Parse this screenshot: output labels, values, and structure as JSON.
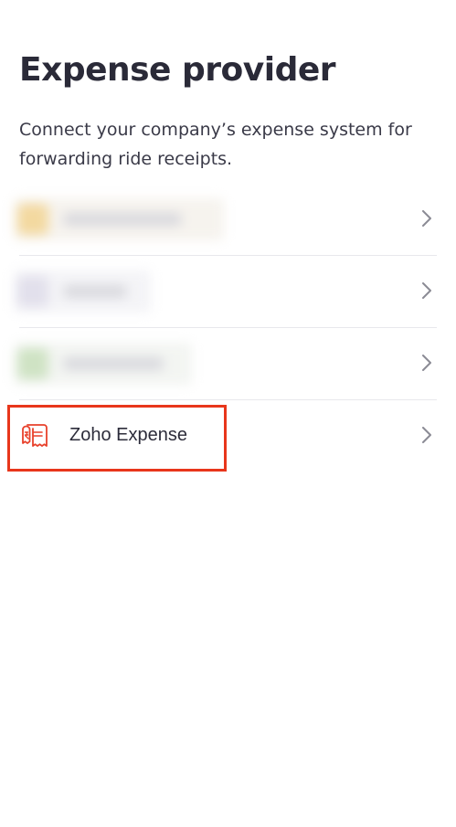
{
  "header": {
    "title": "Expense provider",
    "subtitle": "Connect your company’s expense system for forwarding ride receipts."
  },
  "providers": [
    {
      "label": "",
      "redacted": true,
      "logo_color": "#f3d9a0"
    },
    {
      "label": "",
      "redacted": true,
      "logo_color": "#e2e0ec"
    },
    {
      "label": "",
      "redacted": true,
      "logo_color": "#cfe3c4"
    },
    {
      "label": "Zoho Expense",
      "redacted": false,
      "icon": "zoho-expense-receipt-icon",
      "icon_color": "#e8412b"
    }
  ],
  "colors": {
    "highlight": "#e8361b",
    "chevron": "#8b8b95",
    "divider": "#e8e8ec"
  }
}
